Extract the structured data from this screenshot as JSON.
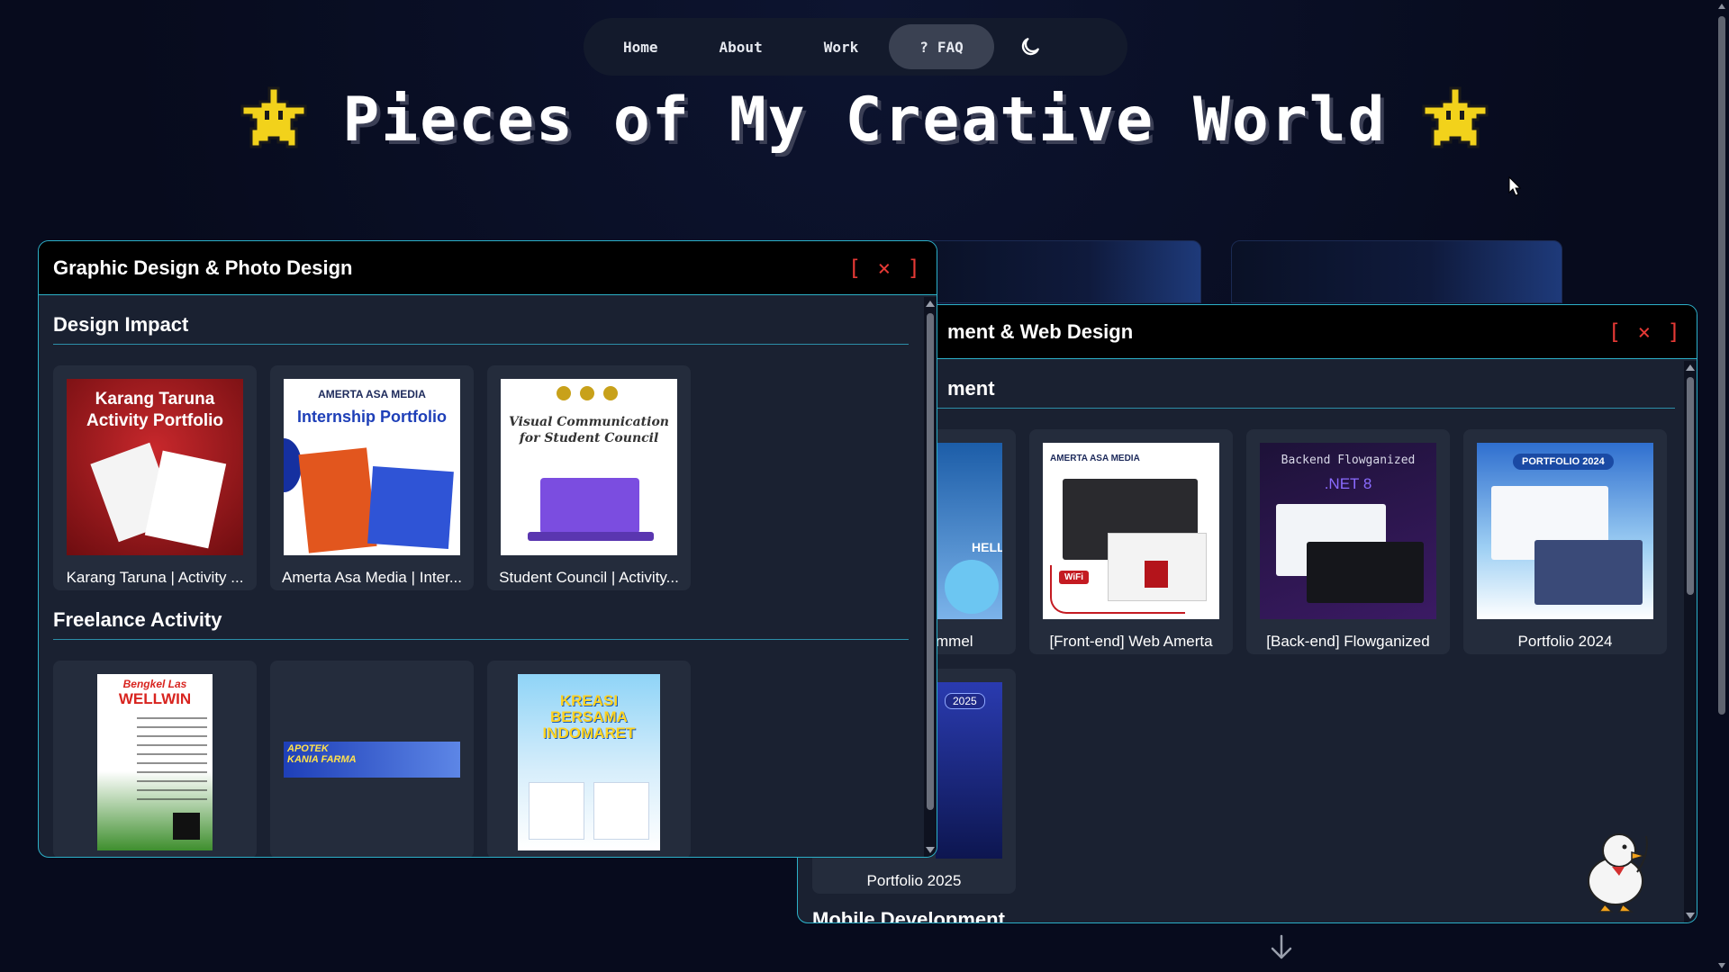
{
  "nav": {
    "items": [
      {
        "label": "Home"
      },
      {
        "label": "About"
      },
      {
        "label": "Work"
      },
      {
        "label": "FAQ",
        "icon": "question-icon",
        "active": true
      }
    ],
    "theme_toggle_icon": "moon-icon"
  },
  "hero": {
    "title": "Pieces of My Creative World",
    "decoration_icon": "pixel-star-icon"
  },
  "window_graphic": {
    "title": "Graphic Design & Photo Design",
    "close_label": "[ × ]",
    "sections": [
      {
        "title": "Design Impact",
        "items": [
          {
            "label": "Karang Taruna | Activity ...",
            "thumb_text": [
              "Karang Taruna",
              "Activity Portfolio"
            ]
          },
          {
            "label": "Amerta Asa Media | Inter...",
            "thumb_text": [
              "AMERTA ASA MEDIA",
              "Internship Portfolio"
            ]
          },
          {
            "label": "Student Council | Activity...",
            "thumb_text": [
              "Visual Communication",
              "for Student Council"
            ]
          }
        ]
      },
      {
        "title": "Freelance Activity",
        "items": [
          {
            "label": "",
            "thumb_text": [
              "Bengkel Las",
              "WELLWIN"
            ]
          },
          {
            "label": "",
            "thumb_text": [
              "APOTEK",
              "KANIA FARMA"
            ]
          },
          {
            "label": "",
            "thumb_text": [
              "KREASI",
              "BERSAMA",
              "INDOMARET"
            ]
          }
        ]
      }
    ]
  },
  "window_web": {
    "title": "ment & Web Design",
    "close_label": "[ × ]",
    "section_title": "ment",
    "items": [
      {
        "label": "mmel"
      },
      {
        "label": "[Front-end] Web Amerta",
        "thumb_text": [
          "AMERTA ASA MEDIA"
        ]
      },
      {
        "label": "[Back-end] Flowganized",
        "thumb_text": [
          "Backend Flowganized",
          ".NET 8"
        ]
      },
      {
        "label": "Portfolio 2024",
        "thumb_text": [
          "PORTFOLIO 2024"
        ]
      },
      {
        "label": "Portfolio 2025",
        "thumb_text": [
          "2025"
        ]
      }
    ],
    "next_section_title": "Mobile Development"
  },
  "scroll_down_icon": "arrow-down-icon",
  "mascot_icon": "duck-mascot-icon",
  "colors": {
    "accent": "#2cb0c8",
    "close": "#e53935",
    "background": "#070b1d",
    "card": "#242c3c"
  }
}
